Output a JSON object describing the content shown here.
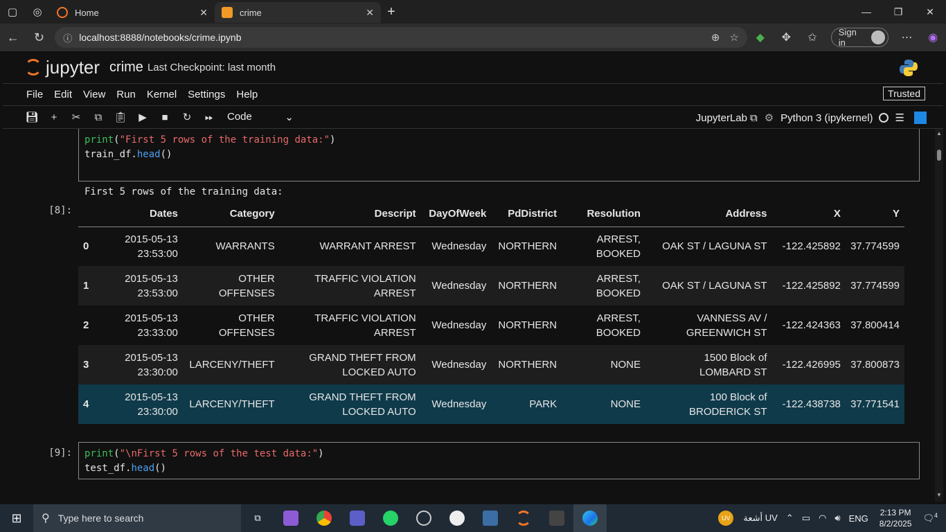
{
  "browser": {
    "tabs": [
      {
        "title": "Home",
        "favicon_color": "#f37626"
      },
      {
        "title": "crime",
        "favicon_color": "#f39a26"
      }
    ],
    "url": "localhost:8888/notebooks/crime.ipynb",
    "sign_in_label": "Sign in"
  },
  "jupyter": {
    "logo_text": "jupyter",
    "notebook_name": "crime",
    "checkpoint": "Last Checkpoint: last month",
    "menu": [
      "File",
      "Edit",
      "View",
      "Run",
      "Kernel",
      "Settings",
      "Help"
    ],
    "trusted_label": "Trusted",
    "cell_type": "Code",
    "jupyterlab_label": "JupyterLab",
    "kernel_name": "Python 3 (ipykernel)"
  },
  "cells": {
    "cell7": {
      "prompt": "[ ]:",
      "line1": {
        "fn": "print",
        "open": "(",
        "str": "\"First 5 rows of the training data:\"",
        "close": ")"
      },
      "line2": {
        "obj": "train_df.",
        "method": "head",
        "args": "()"
      }
    },
    "output8": {
      "prompt": "[8]:",
      "text": "First 5 rows of the training data:",
      "columns": [
        "",
        "Dates",
        "Category",
        "Descript",
        "DayOfWeek",
        "PdDistrict",
        "Resolution",
        "Address",
        "X",
        "Y"
      ],
      "rows": [
        {
          "idx": "0",
          "dates": "2015-05-13 23:53:00",
          "category": "WARRANTS",
          "descript": "WARRANT ARREST",
          "day": "Wednesday",
          "district": "NORTHERN",
          "resolution": "ARREST, BOOKED",
          "address": "OAK ST / LAGUNA ST",
          "x": "-122.425892",
          "y": "37.774599"
        },
        {
          "idx": "1",
          "dates": "2015-05-13 23:53:00",
          "category": "OTHER OFFENSES",
          "descript": "TRAFFIC VIOLATION ARREST",
          "day": "Wednesday",
          "district": "NORTHERN",
          "resolution": "ARREST, BOOKED",
          "address": "OAK ST / LAGUNA ST",
          "x": "-122.425892",
          "y": "37.774599"
        },
        {
          "idx": "2",
          "dates": "2015-05-13 23:33:00",
          "category": "OTHER OFFENSES",
          "descript": "TRAFFIC VIOLATION ARREST",
          "day": "Wednesday",
          "district": "NORTHERN",
          "resolution": "ARREST, BOOKED",
          "address": "VANNESS AV / GREENWICH ST",
          "x": "-122.424363",
          "y": "37.800414"
        },
        {
          "idx": "3",
          "dates": "2015-05-13 23:30:00",
          "category": "LARCENY/THEFT",
          "descript": "GRAND THEFT FROM LOCKED AUTO",
          "day": "Wednesday",
          "district": "NORTHERN",
          "resolution": "NONE",
          "address": "1500 Block of LOMBARD ST",
          "x": "-122.426995",
          "y": "37.800873"
        },
        {
          "idx": "4",
          "dates": "2015-05-13 23:30:00",
          "category": "LARCENY/THEFT",
          "descript": "GRAND THEFT FROM LOCKED AUTO",
          "day": "Wednesday",
          "district": "PARK",
          "resolution": "NONE",
          "address": "100 Block of BRODERICK ST",
          "x": "-122.438738",
          "y": "37.771541"
        }
      ]
    },
    "cell9": {
      "prompt": "[9]:",
      "line1": {
        "fn": "print",
        "open": "(",
        "str": "\"\\nFirst 5 rows of the test data:\"",
        "close": ")"
      },
      "line2": {
        "obj": "test_df.",
        "method": "head",
        "args": "()"
      }
    }
  },
  "taskbar": {
    "search_placeholder": "Type here to search",
    "weather": "أشعة UV",
    "weather_badge": "UV",
    "language": "ENG",
    "time": "2:13 PM",
    "date": "8/2/2025",
    "notifications": "4"
  }
}
